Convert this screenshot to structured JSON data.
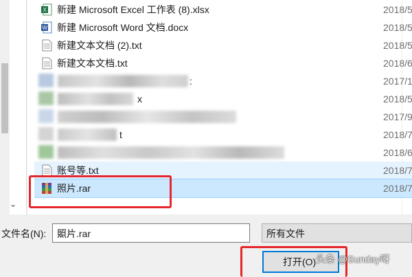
{
  "files": [
    {
      "name": "新建 Microsoft Excel 工作表 (8).xlsx",
      "date": "2018/5",
      "icon": "excel-icon"
    },
    {
      "name": "新建 Microsoft Word 文档.docx",
      "date": "2018/5",
      "icon": "word-icon"
    },
    {
      "name": "新建文本文档 (2).txt",
      "date": "2018/5",
      "icon": "text-file-icon"
    },
    {
      "name": "新建文本文档.txt",
      "date": "2018/6",
      "icon": "text-file-icon"
    },
    {
      "name": "",
      "date": "2017/1",
      "icon": "blurred"
    },
    {
      "name": "x",
      "date": "2018/5",
      "icon": "blurred"
    },
    {
      "name": "",
      "date": "2017/9",
      "icon": "blurred"
    },
    {
      "name": "t",
      "date": "2018/7",
      "icon": "blurred"
    },
    {
      "name": "",
      "date": "2018/6",
      "icon": "blurred"
    },
    {
      "name": "账号等.txt",
      "date": "2018/7",
      "icon": "text-file-icon"
    },
    {
      "name": "照片.rar",
      "date": "2018/7",
      "icon": "rar-archive-icon"
    }
  ],
  "blurred_row_4_suffix": ":",
  "filename_label": "文件名(N):",
  "filename_value": "照片.rar",
  "filetype_value": "所有文件",
  "open_button": "打开(O)",
  "watermark": "头条 @Sunday呀",
  "colors": {
    "selection": "#cce8ff",
    "hover": "#e5f3ff",
    "highlight_box": "#e5262b",
    "button_border": "#0078d7"
  }
}
